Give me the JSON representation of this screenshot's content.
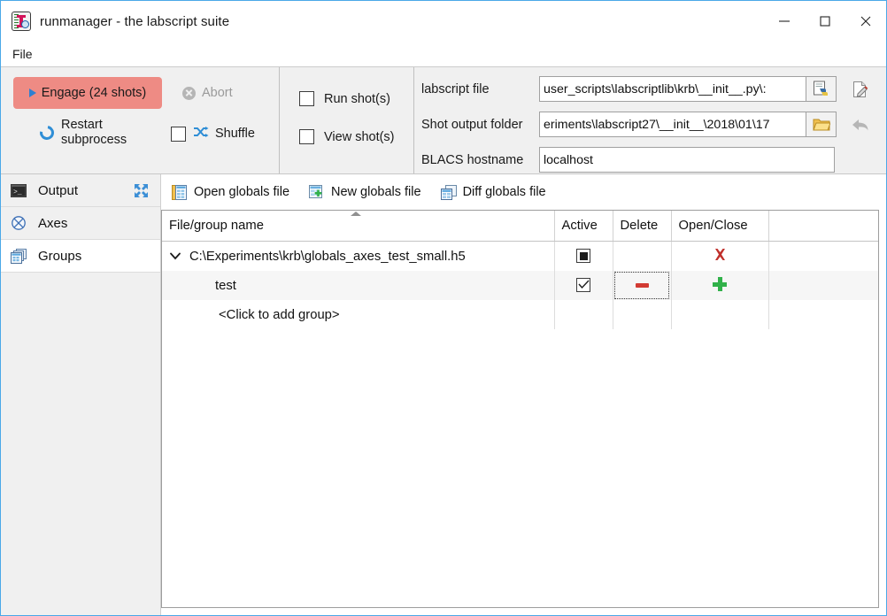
{
  "window": {
    "title": "runmanager - the labscript suite",
    "app_icon": "runmanager-icon",
    "controls": {
      "minimize": "minimize-icon",
      "maximize": "maximize-icon",
      "close": "close-icon"
    }
  },
  "menubar": {
    "items": [
      {
        "label": "File"
      }
    ]
  },
  "toolbar": {
    "engage": {
      "label": "Engage (24 shots)",
      "shots": 24,
      "color": "#ee8b84",
      "icon": "play-icon"
    },
    "abort": {
      "label": "Abort",
      "enabled": false,
      "icon": "abort-icon"
    },
    "restart": {
      "label_line1": "Restart",
      "label_line2": "subprocess",
      "icon": "restart-icon"
    },
    "shuffle": {
      "label": "Shuffle",
      "checked": false,
      "icon": "shuffle-icon"
    },
    "run_shots": {
      "label": "Run shot(s)",
      "checked": false
    },
    "view_shots": {
      "label": "View shot(s)",
      "checked": false
    }
  },
  "fields": {
    "labscript_file": {
      "label": "labscript file",
      "value": ":\\user_scripts\\labscriptlib\\krb\\__init__.py",
      "browse_icon": "python-file-browse-icon",
      "side_icon": "edit-file-icon"
    },
    "shot_output_folder": {
      "label": "Shot output folder",
      "value": "eriments\\labscript27\\__init__\\2018\\01\\17",
      "browse_icon": "folder-browse-icon",
      "side_icon": "reset-arrow-icon"
    },
    "blacs_hostname": {
      "label": "BLACS hostname",
      "value": "localhost",
      "placeholder": "localhost"
    }
  },
  "sidebar": {
    "items": [
      {
        "label": "Output",
        "icon": "terminal-icon",
        "selected": false,
        "expand_icon": "expand-arrows-icon"
      },
      {
        "label": "Axes",
        "icon": "axes-circle-cross-icon",
        "selected": false
      },
      {
        "label": "Groups",
        "icon": "groups-windows-icon",
        "selected": true
      }
    ]
  },
  "globals_toolbar": {
    "buttons": [
      {
        "label": "Open globals file",
        "icon": "open-globals-file-icon"
      },
      {
        "label": "New globals file",
        "icon": "new-globals-file-icon"
      },
      {
        "label": "Diff globals file",
        "icon": "diff-globals-file-icon"
      }
    ]
  },
  "globals_table": {
    "columns": [
      "File/group name",
      "Active",
      "Delete",
      "Open/Close"
    ],
    "rows": [
      {
        "type": "file",
        "name": "C:\\Experiments\\krb\\globals_axes_test_small.h5",
        "chevron": "chevron-down-icon",
        "active": "partial",
        "delete": "",
        "open_close": "close-x-icon",
        "alt": false
      },
      {
        "type": "group",
        "name": "test",
        "chevron": "",
        "active": "checked",
        "delete": "minus-icon",
        "open_close": "plus-icon",
        "alt": true
      },
      {
        "type": "add",
        "name": "<Click to add group>",
        "chevron": "",
        "active": "",
        "delete": "",
        "open_close": "",
        "alt": false
      }
    ]
  },
  "colors": {
    "window_border": "#4aa8e8",
    "toolbar_bg": "#f0f0f0",
    "engage_bg": "#ee8b84",
    "accent_blue": "#2f8ed6",
    "danger_red": "#c0302b",
    "success_green": "#31b14a"
  }
}
